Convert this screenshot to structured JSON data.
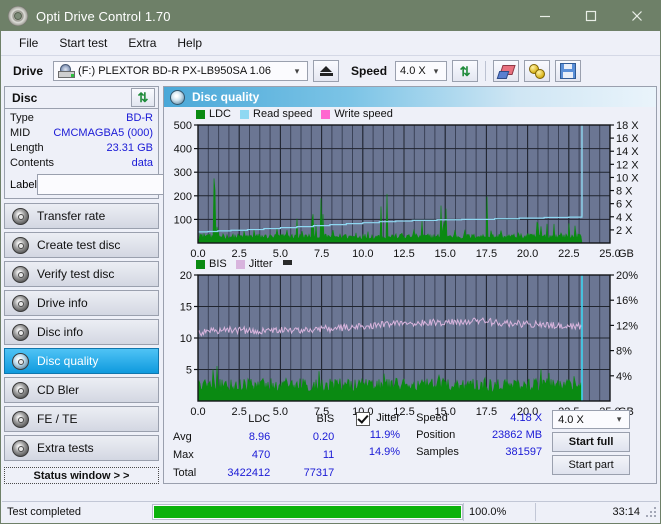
{
  "window": {
    "title": "Opti Drive Control 1.70",
    "icon": "disc-icon",
    "minimize": "minimize-icon",
    "maximize": "maximize-icon",
    "close": "close-icon"
  },
  "menu": {
    "items": [
      {
        "label": "File",
        "accel": "F"
      },
      {
        "label": "Start test",
        "accel": "S"
      },
      {
        "label": "Extra",
        "accel": "x"
      },
      {
        "label": "Help",
        "accel": "H"
      }
    ]
  },
  "toolbar": {
    "drive_label": "Drive",
    "drive_value": "(F:)  PLEXTOR BD-R  PX-LB950SA 1.06",
    "eject_icon": "eject-icon",
    "speed_label": "Speed",
    "speed_value": "4.0 X",
    "refresh_icon": "refresh-icon",
    "erase_icon": "erase-icon",
    "settings_icon": "gold-discs-icon",
    "save_icon": "save-icon"
  },
  "disc_panel": {
    "title": "Disc",
    "refresh_icon": "refresh-icon",
    "rows": [
      {
        "key": "Type",
        "value": "BD-R"
      },
      {
        "key": "MID",
        "value": "CMCMAGBA5 (000)"
      },
      {
        "key": "Length",
        "value": "23.31 GB"
      },
      {
        "key": "Contents",
        "value": "data"
      }
    ],
    "label_key": "Label",
    "label_value": "",
    "label_placeholder": "",
    "label_button_icon": "cd-icon"
  },
  "sidebar": {
    "items": [
      {
        "label": "Transfer rate",
        "icon": "disc-icon",
        "active": false
      },
      {
        "label": "Create test disc",
        "icon": "disc-icon",
        "active": false
      },
      {
        "label": "Verify test disc",
        "icon": "disc-icon",
        "active": false
      },
      {
        "label": "Drive info",
        "icon": "disc-icon",
        "active": false
      },
      {
        "label": "Disc info",
        "icon": "disc-icon",
        "active": false
      },
      {
        "label": "Disc quality",
        "icon": "disc-icon",
        "active": true
      },
      {
        "label": "CD Bler",
        "icon": "disc-icon",
        "active": false
      },
      {
        "label": "FE / TE",
        "icon": "disc-icon",
        "active": false
      },
      {
        "label": "Extra tests",
        "icon": "disc-icon",
        "active": false
      }
    ],
    "status_window_button": "Status window > >"
  },
  "main": {
    "title": "Disc quality",
    "title_icon": "disc-icon"
  },
  "chart_data": [
    {
      "type": "line",
      "name": "ldc-chart",
      "title": "",
      "legend": [
        {
          "label": "LDC",
          "color": "#0a8a12"
        },
        {
          "label": "Read speed",
          "color": "#8fd8f2"
        },
        {
          "label": "Write speed",
          "color": "#ff66d0"
        }
      ],
      "legend_position": "top-left",
      "xlabel": "GB",
      "x_ticks": [
        "0.0",
        "2.5",
        "5.0",
        "7.5",
        "10.0",
        "12.5",
        "15.0",
        "17.5",
        "20.0",
        "22.5",
        "25.0"
      ],
      "xlim": [
        0,
        25
      ],
      "ylabel_left": "",
      "y_ticks_left": [
        "100",
        "200",
        "300",
        "400",
        "500"
      ],
      "ylim_left": [
        0,
        500
      ],
      "ylabel_right": "X",
      "y_ticks_right": [
        "2 X",
        "4 X",
        "6 X",
        "8 X",
        "10 X",
        "12 X",
        "14 X",
        "16 X",
        "18 X"
      ],
      "ylim_right": [
        0,
        18
      ],
      "grid": true,
      "plot_bg": "#6b7693",
      "series": [
        {
          "name": "LDC",
          "color": "#0a8a12",
          "type": "area-spikes",
          "x_end": 23.3,
          "baseline": 28,
          "spikes": [
            {
              "x": 0.15,
              "y": 90
            },
            {
              "x": 0.35,
              "y": 55
            },
            {
              "x": 0.62,
              "y": 48
            },
            {
              "x": 0.95,
              "y": 470
            },
            {
              "x": 1.05,
              "y": 360
            },
            {
              "x": 1.18,
              "y": 150
            },
            {
              "x": 1.5,
              "y": 60
            },
            {
              "x": 2.1,
              "y": 55
            },
            {
              "x": 2.8,
              "y": 62
            },
            {
              "x": 3.4,
              "y": 58
            },
            {
              "x": 4.1,
              "y": 52
            },
            {
              "x": 4.8,
              "y": 70
            },
            {
              "x": 5.4,
              "y": 56
            },
            {
              "x": 6.0,
              "y": 120
            },
            {
              "x": 6.3,
              "y": 64
            },
            {
              "x": 6.95,
              "y": 280
            },
            {
              "x": 7.15,
              "y": 100
            },
            {
              "x": 7.45,
              "y": 260
            },
            {
              "x": 7.6,
              "y": 175
            },
            {
              "x": 8.2,
              "y": 66
            },
            {
              "x": 8.9,
              "y": 60
            },
            {
              "x": 9.6,
              "y": 58
            },
            {
              "x": 10.3,
              "y": 70
            },
            {
              "x": 11.1,
              "y": 170
            },
            {
              "x": 11.45,
              "y": 330
            },
            {
              "x": 11.8,
              "y": 80
            },
            {
              "x": 12.4,
              "y": 72
            },
            {
              "x": 13.1,
              "y": 66
            },
            {
              "x": 13.6,
              "y": 110
            },
            {
              "x": 14.3,
              "y": 60
            },
            {
              "x": 14.72,
              "y": 320
            },
            {
              "x": 14.9,
              "y": 200
            },
            {
              "x": 15.05,
              "y": 150
            },
            {
              "x": 15.6,
              "y": 62
            },
            {
              "x": 16.2,
              "y": 58
            },
            {
              "x": 16.9,
              "y": 64
            },
            {
              "x": 17.55,
              "y": 270
            },
            {
              "x": 17.8,
              "y": 90
            },
            {
              "x": 18.4,
              "y": 74
            },
            {
              "x": 18.9,
              "y": 62
            },
            {
              "x": 19.4,
              "y": 68
            },
            {
              "x": 20.0,
              "y": 78
            },
            {
              "x": 20.6,
              "y": 215
            },
            {
              "x": 20.8,
              "y": 96
            },
            {
              "x": 21.2,
              "y": 150
            },
            {
              "x": 21.6,
              "y": 84
            },
            {
              "x": 22.0,
              "y": 92
            },
            {
              "x": 22.5,
              "y": 110
            },
            {
              "x": 22.9,
              "y": 140
            },
            {
              "x": 23.15,
              "y": 88
            }
          ]
        },
        {
          "name": "Read speed",
          "color": "#8fd8f2",
          "type": "step",
          "points": [
            {
              "x": 0.0,
              "y": 1.7
            },
            {
              "x": 0.6,
              "y": 1.75
            },
            {
              "x": 1.2,
              "y": 1.85
            },
            {
              "x": 2.0,
              "y": 1.95
            },
            {
              "x": 3.0,
              "y": 2.05
            },
            {
              "x": 4.0,
              "y": 2.2
            },
            {
              "x": 5.0,
              "y": 2.35
            },
            {
              "x": 6.0,
              "y": 2.5
            },
            {
              "x": 7.0,
              "y": 2.65
            },
            {
              "x": 8.0,
              "y": 2.8
            },
            {
              "x": 9.0,
              "y": 2.95
            },
            {
              "x": 10.0,
              "y": 3.1
            },
            {
              "x": 11.0,
              "y": 3.25
            },
            {
              "x": 12.0,
              "y": 3.35
            },
            {
              "x": 13.0,
              "y": 3.45
            },
            {
              "x": 14.5,
              "y": 3.55
            },
            {
              "x": 16.0,
              "y": 3.6
            },
            {
              "x": 18.0,
              "y": 3.7
            },
            {
              "x": 19.5,
              "y": 3.8
            },
            {
              "x": 21.0,
              "y": 3.9
            },
            {
              "x": 22.5,
              "y": 3.95
            },
            {
              "x": 23.3,
              "y": 4.0
            }
          ],
          "end_vertical": {
            "x": 23.3,
            "y_from": 4.0,
            "y_to": 18.0
          }
        }
      ]
    },
    {
      "type": "line",
      "name": "bis-jitter-chart",
      "title": "",
      "legend": [
        {
          "label": "BIS",
          "color": "#0a8a12"
        },
        {
          "label": "Jitter",
          "color": "#d8b4dd"
        }
      ],
      "legend_position": "top-left",
      "xlabel": "GB",
      "x_ticks": [
        "0.0",
        "2.5",
        "5.0",
        "7.5",
        "10.0",
        "12.5",
        "15.0",
        "17.5",
        "20.0",
        "22.5",
        "25.0"
      ],
      "xlim": [
        0,
        25
      ],
      "y_ticks_left": [
        "5",
        "10",
        "15",
        "20"
      ],
      "ylim_left": [
        0,
        20
      ],
      "y_ticks_right": [
        "4%",
        "8%",
        "12%",
        "16%",
        "20%"
      ],
      "ylim_right": [
        0,
        20
      ],
      "grid": true,
      "plot_bg": "#6b7693",
      "series": [
        {
          "name": "BIS",
          "color": "#0a8a12",
          "type": "area-spikes",
          "x_end": 23.3,
          "baseline": 2.6,
          "spikes": [
            {
              "x": 0.1,
              "y": 3.4
            },
            {
              "x": 0.45,
              "y": 6.0
            },
            {
              "x": 0.9,
              "y": 6.3
            },
            {
              "x": 1.0,
              "y": 4.2
            },
            {
              "x": 1.15,
              "y": 5.9
            },
            {
              "x": 1.6,
              "y": 3.2
            },
            {
              "x": 2.4,
              "y": 3.3
            },
            {
              "x": 3.2,
              "y": 3.1
            },
            {
              "x": 4.0,
              "y": 3.4
            },
            {
              "x": 4.9,
              "y": 3.2
            },
            {
              "x": 5.7,
              "y": 3.3
            },
            {
              "x": 6.6,
              "y": 3.5
            },
            {
              "x": 6.95,
              "y": 5.2
            },
            {
              "x": 7.35,
              "y": 5.6
            },
            {
              "x": 7.5,
              "y": 4.3
            },
            {
              "x": 8.3,
              "y": 3.3
            },
            {
              "x": 9.1,
              "y": 3.4
            },
            {
              "x": 9.9,
              "y": 3.2
            },
            {
              "x": 10.6,
              "y": 3.6
            },
            {
              "x": 11.3,
              "y": 6.0
            },
            {
              "x": 11.7,
              "y": 4.0
            },
            {
              "x": 12.5,
              "y": 3.5
            },
            {
              "x": 13.2,
              "y": 3.4
            },
            {
              "x": 13.9,
              "y": 3.3
            },
            {
              "x": 14.6,
              "y": 7.8
            },
            {
              "x": 14.85,
              "y": 4.4
            },
            {
              "x": 15.5,
              "y": 3.4
            },
            {
              "x": 16.3,
              "y": 3.5
            },
            {
              "x": 17.4,
              "y": 5.3
            },
            {
              "x": 17.7,
              "y": 5.5
            },
            {
              "x": 18.3,
              "y": 3.8
            },
            {
              "x": 19.2,
              "y": 3.6
            },
            {
              "x": 20.0,
              "y": 3.5
            },
            {
              "x": 20.8,
              "y": 6.8
            },
            {
              "x": 21.3,
              "y": 4.6
            },
            {
              "x": 21.8,
              "y": 4.2
            },
            {
              "x": 22.4,
              "y": 3.9
            },
            {
              "x": 22.8,
              "y": 5.7
            },
            {
              "x": 23.1,
              "y": 4.3
            }
          ]
        },
        {
          "name": "Jitter",
          "color": "#d8b4dd",
          "type": "noisy-line",
          "x_end": 23.3,
          "points": [
            {
              "x": 0.0,
              "y": 10.8
            },
            {
              "x": 1.0,
              "y": 11.1
            },
            {
              "x": 2.0,
              "y": 11.3
            },
            {
              "x": 3.0,
              "y": 11.2
            },
            {
              "x": 4.0,
              "y": 11.1
            },
            {
              "x": 5.0,
              "y": 11.2
            },
            {
              "x": 6.0,
              "y": 11.3
            },
            {
              "x": 7.0,
              "y": 11.4
            },
            {
              "x": 8.0,
              "y": 11.5
            },
            {
              "x": 9.0,
              "y": 11.7
            },
            {
              "x": 10.0,
              "y": 11.9
            },
            {
              "x": 11.0,
              "y": 12.1
            },
            {
              "x": 12.0,
              "y": 12.4
            },
            {
              "x": 13.0,
              "y": 12.4
            },
            {
              "x": 14.0,
              "y": 12.5
            },
            {
              "x": 15.0,
              "y": 12.5
            },
            {
              "x": 16.0,
              "y": 12.6
            },
            {
              "x": 17.0,
              "y": 12.7
            },
            {
              "x": 18.0,
              "y": 12.5
            },
            {
              "x": 19.0,
              "y": 12.3
            },
            {
              "x": 20.0,
              "y": 12.2
            },
            {
              "x": 21.0,
              "y": 12.1
            },
            {
              "x": 22.0,
              "y": 11.9
            },
            {
              "x": 23.3,
              "y": 11.8
            }
          ],
          "noise": 0.55
        }
      ],
      "cursor_line": {
        "x": 23.3,
        "color": "#3fd4f0"
      }
    }
  ],
  "stats": {
    "col_headers": [
      "LDC",
      "BIS"
    ],
    "rows": [
      {
        "key": "Avg",
        "ldc": "8.96",
        "bis": "0.20",
        "jitter": "11.9%"
      },
      {
        "key": "Max",
        "ldc": "470",
        "bis": "11",
        "jitter": "14.9%"
      },
      {
        "key": "Total",
        "ldc": "3422412",
        "bis": "77317",
        "jitter": ""
      }
    ],
    "jitter_label": "Jitter",
    "jitter_checked": true,
    "speed_label": "Speed",
    "speed_value": "4.18 X",
    "position_label": "Position",
    "position_value": "23862 MB",
    "samples_label": "Samples",
    "samples_value": "381597",
    "speed_select": "4.0 X",
    "start_full_button": "Start full",
    "start_part_button": "Start part"
  },
  "statusbar": {
    "message": "Test completed",
    "progress_percent": 100,
    "progress_text": "100.0%",
    "elapsed": "33:14"
  }
}
